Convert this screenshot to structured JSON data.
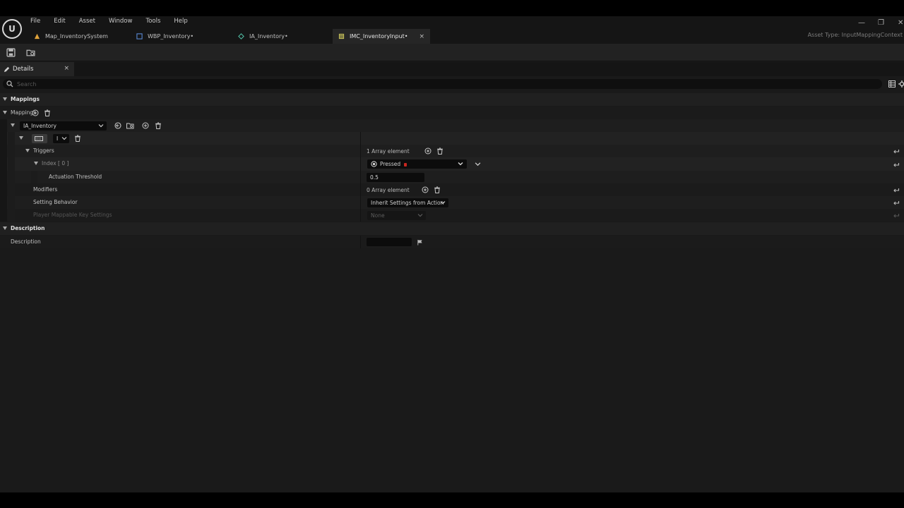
{
  "menu": [
    "File",
    "Edit",
    "Asset",
    "Window",
    "Tools",
    "Help"
  ],
  "tabs": [
    {
      "label": "Map_InventorySystem"
    },
    {
      "label": "WBP_Inventory•"
    },
    {
      "label": "IA_Inventory•"
    },
    {
      "label": "IMC_InventoryInput•",
      "close": "×"
    }
  ],
  "asset_type": "Asset Type: InputMappingContext",
  "details": {
    "tab_label": "Details",
    "close": "×"
  },
  "search": {
    "placeholder": "Search"
  },
  "categories": {
    "mappings": "Mappings",
    "description": "Description"
  },
  "mappings_row": {
    "label": "Mappings"
  },
  "action_combo": {
    "value": "IA_Inventory"
  },
  "key_combo": {
    "value": "I"
  },
  "triggers": {
    "label": "Triggers",
    "value": "1 Array element"
  },
  "index0": {
    "label": "Index [ 0 ]",
    "value": "Pressed"
  },
  "actuation": {
    "label": "Actuation Threshold",
    "value": "0.5"
  },
  "modifiers": {
    "label": "Modifiers",
    "value": "0 Array element"
  },
  "setting_behavior": {
    "label": "Setting Behavior",
    "value": "Inherit Settings from Action"
  },
  "player_mappable": {
    "label": "Player Mappable Key Settings",
    "value": "None"
  },
  "description_row": {
    "label": "Description",
    "value": ""
  },
  "colors": {
    "accent_red": "#c8261f",
    "background": "#1a1a1a",
    "field": "#0c0c0c"
  }
}
